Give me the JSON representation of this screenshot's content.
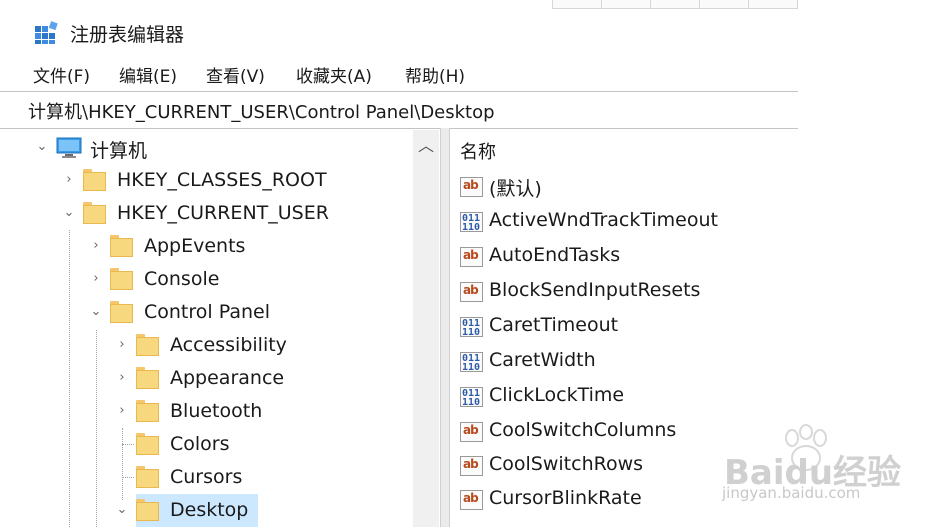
{
  "window": {
    "title": "注册表编辑器"
  },
  "menu": [
    {
      "label": "文件(F)"
    },
    {
      "label": "编辑(E)"
    },
    {
      "label": "查看(V)"
    },
    {
      "label": "收藏夹(A)"
    },
    {
      "label": "帮助(H)"
    }
  ],
  "address": {
    "path": "计算机\\HKEY_CURRENT_USER\\Control Panel\\Desktop"
  },
  "tree": {
    "root": "计算机",
    "nodes": [
      {
        "label": "HKEY_CLASSES_ROOT",
        "expanded": false
      },
      {
        "label": "HKEY_CURRENT_USER",
        "expanded": true
      },
      {
        "label": "AppEvents",
        "expanded": false
      },
      {
        "label": "Console",
        "expanded": false
      },
      {
        "label": "Control Panel",
        "expanded": true
      },
      {
        "label": "Accessibility",
        "expanded": false
      },
      {
        "label": "Appearance",
        "expanded": false
      },
      {
        "label": "Bluetooth",
        "expanded": false
      },
      {
        "label": "Colors",
        "expanded": null
      },
      {
        "label": "Cursors",
        "expanded": null
      },
      {
        "label": "Desktop",
        "expanded": true,
        "selected": true
      }
    ]
  },
  "values": {
    "column_name": "名称",
    "items": [
      {
        "name": "(默认)",
        "type": "REG_SZ",
        "icon": "string-value-icon"
      },
      {
        "name": "ActiveWndTrackTimeout",
        "type": "REG_DWORD",
        "icon": "dword-value-icon"
      },
      {
        "name": "AutoEndTasks",
        "type": "REG_SZ",
        "icon": "string-value-icon"
      },
      {
        "name": "BlockSendInputResets",
        "type": "REG_SZ",
        "icon": "string-value-icon"
      },
      {
        "name": "CaretTimeout",
        "type": "REG_DWORD",
        "icon": "dword-value-icon"
      },
      {
        "name": "CaretWidth",
        "type": "REG_DWORD",
        "icon": "dword-value-icon"
      },
      {
        "name": "ClickLockTime",
        "type": "REG_DWORD",
        "icon": "dword-value-icon"
      },
      {
        "name": "CoolSwitchColumns",
        "type": "REG_SZ",
        "icon": "string-value-icon"
      },
      {
        "name": "CoolSwitchRows",
        "type": "REG_SZ",
        "icon": "string-value-icon"
      },
      {
        "name": "CursorBlinkRate",
        "type": "REG_SZ",
        "icon": "string-value-icon"
      }
    ]
  },
  "icon_text": {
    "sz": "ab",
    "dword": "011\n110"
  },
  "watermark": {
    "brand": "Baidu经验",
    "site": "jingyan.baidu.com"
  },
  "colors": {
    "selection": "#cce8ff",
    "folder": "#f8d87e",
    "accent": "#2d5ba8"
  }
}
